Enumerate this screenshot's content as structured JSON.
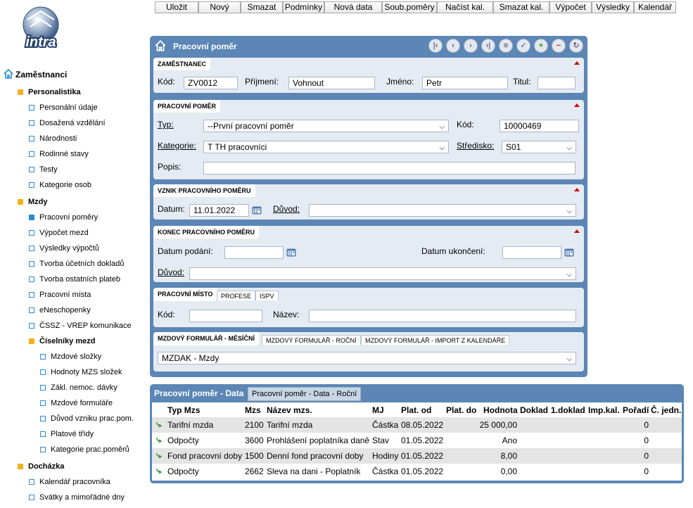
{
  "toolbar": {
    "buttons": [
      "Uložit",
      "Nový",
      "Smazat",
      "Podmínky",
      "Nová data",
      "Soub.poměry",
      "Načíst kal.",
      "Smazat kal.",
      "Výpočet",
      "Výsledky",
      "Kalendář"
    ]
  },
  "logo": {
    "text": "intra"
  },
  "tree": {
    "root": "Zaměstnanci",
    "personalistika": {
      "label": "Personalistika",
      "items": [
        "Personální údaje",
        "Dosažená vzdělání",
        "Národnosti",
        "Rodinné stavy",
        "Testy",
        "Kategorie osob"
      ]
    },
    "mzdy": {
      "label": "Mzdy",
      "items": [
        "Pracovní poměry",
        "Výpočet mezd",
        "Výsledky výpočtů",
        "Tvorba účetních dokladů",
        "Tvorba ostatních plateb",
        "Pracovní místa",
        "eNeschopenky",
        "ČSSZ - VREP komunikace"
      ],
      "ciselniky": {
        "label": "Číselníky mezd",
        "items": [
          "Mzdové složky",
          "Hodnoty MZS složek",
          "Zákl. nemoc. dávky",
          "Mzdové formuláře",
          "Důvod vzniku prac.pom.",
          "Platové třídy",
          "Kategorie prac.poměrů"
        ]
      }
    },
    "dochazka": {
      "label": "Docházka",
      "items": [
        "Kalendář pracovníka",
        "Svátky a mimořádné dny"
      ]
    }
  },
  "panel": {
    "title": "Pracovní poměr",
    "nav_icons": [
      "first-icon",
      "prev-icon",
      "next-icon",
      "last-icon",
      "list-icon",
      "check-icon",
      "add-icon",
      "remove-icon",
      "refresh-icon"
    ],
    "zamestnanec": {
      "title": "ZAMĚSTNANEC",
      "kod_label": "Kód:",
      "kod": "ZV0012",
      "prijmeni_label": "Příjmení:",
      "prijmeni": "Vohnout",
      "jmeno_label": "Jméno:",
      "jmeno": "Petr",
      "titul_label": "Titul:",
      "titul": ""
    },
    "pracovni_pomer": {
      "title": "PRACOVNÍ POMĚR",
      "typ_label": "Typ:",
      "typ": "--První pracovní poměr",
      "kod_label": "Kód:",
      "kod": "10000469",
      "kategorie_label": "Kategorie:",
      "kategorie": "T  TH pracovníci",
      "stredisko_label": "Středisko:",
      "stredisko": "S01",
      "popis_label": "Popis:",
      "popis": ""
    },
    "vznik": {
      "title": "VZNIK PRACOVNÍHO POMĚRU",
      "datum_label": "Datum:",
      "datum": "11.01.2022",
      "duvod_label": "Důvod:",
      "duvod": ""
    },
    "konec": {
      "title": "KONEC PRACOVNÍHO POMĚRU",
      "podani_label": "Datum podání:",
      "podani": "",
      "ukonceni_label": "Datum ukončení:",
      "ukonceni": "",
      "duvod_label": "Důvod:",
      "duvod": ""
    },
    "misto": {
      "tabs": [
        "PRACOVNÍ MÍSTO",
        "PROFESE",
        "ISPV"
      ],
      "kod_label": "Kód:",
      "kod": "",
      "nazev_label": "Název:",
      "nazev": ""
    },
    "formular": {
      "tabs": [
        "MZDOVÝ FORMULÁŘ - MĚSÍČNÍ",
        "MZDOVÝ FORMULÁŘ - ROČNÍ",
        "MZDOVÝ FORMULÁŘ - IMPORT Z KALENDÁŘE"
      ],
      "value": "MZDAK - Mzdy"
    }
  },
  "data_panel": {
    "tab_active": "Pracovní poměr - Data",
    "tab_other": "Pracovní poměr - Data - Roční",
    "columns": [
      "Typ Mzs",
      "Mzs",
      "Název mzs.",
      "MJ",
      "Plat. od",
      "Plat. do",
      "Hodnota",
      "Doklad",
      "1.doklad",
      "Imp.kal.",
      "Pořadí",
      "Č. jedn."
    ],
    "rows": [
      {
        "typ": "Tarifní mzda",
        "mzs": "2100",
        "nazev": "Tarifní mzda",
        "mj": "Částka",
        "od": "08.05.2022",
        "do": "",
        "hodnota": "25 000,00",
        "poradi": "0"
      },
      {
        "typ": "Odpočty",
        "mzs": "3600",
        "nazev": "Prohlášení poplatníka daně",
        "mj": "Stav",
        "od": "01.05.2022",
        "do": "",
        "hodnota": "Ano",
        "poradi": "0"
      },
      {
        "typ": "Fond pracovní doby",
        "mzs": "1500",
        "nazev": "Denní fond pracovní doby",
        "mj": "Hodiny",
        "od": "01.05.2022",
        "do": "",
        "hodnota": "8,00",
        "poradi": "0"
      },
      {
        "typ": "Odpočty",
        "mzs": "2662",
        "nazev": "Sleva na dani - Poplatník",
        "mj": "Částka",
        "od": "01.05.2022",
        "do": "",
        "hodnota": "0,00",
        "poradi": "0"
      }
    ]
  },
  "colors": {
    "panel": "#5b86b5",
    "section": "#e5ebf3",
    "tree_icon": "#2a8bd0",
    "folder": "#f2b21b"
  }
}
